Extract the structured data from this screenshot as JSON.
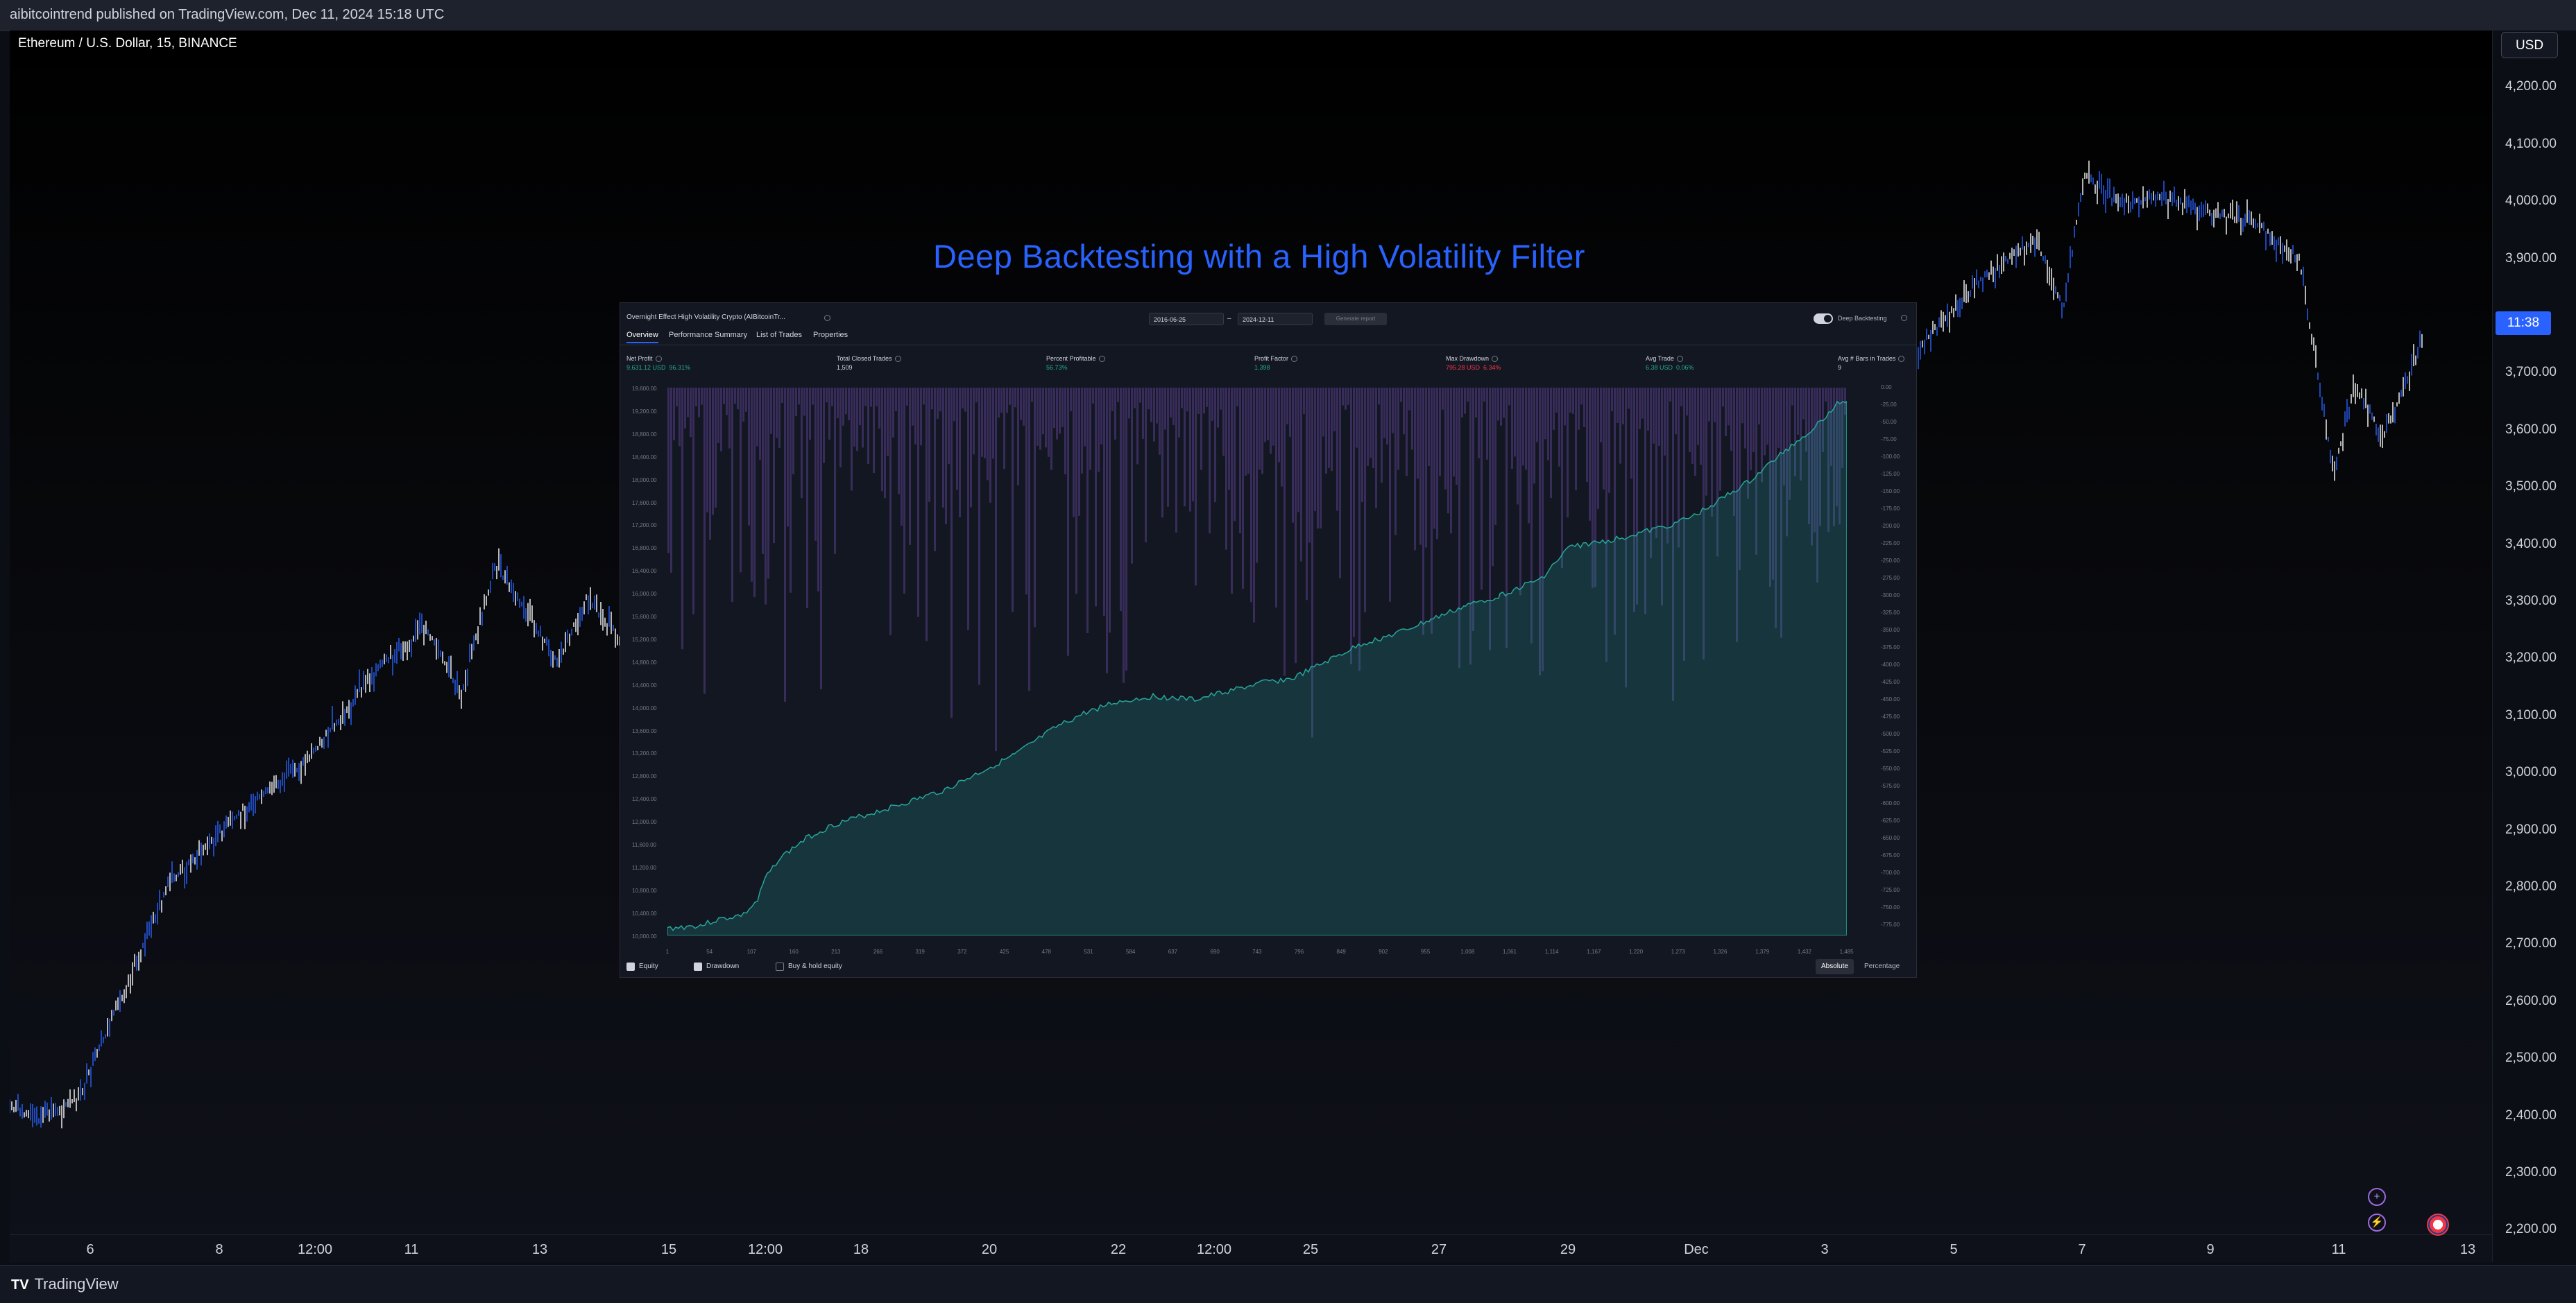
{
  "header": {
    "published_text": "aibitcointrend published on TradingView.com, Dec 11, 2024 15:18 UTC"
  },
  "chart": {
    "symbol": "Ethereum / U.S. Dollar, 15, BINANCE",
    "currency": "USD",
    "current_price_label": "11:38",
    "price_labels": [
      "4,200.00",
      "4,100.00",
      "4,000.00",
      "3,900.00",
      "3,700.00",
      "3,600.00",
      "3,500.00",
      "3,400.00",
      "3,300.00",
      "3,200.00",
      "3,100.00",
      "3,000.00",
      "2,900.00",
      "2,800.00",
      "2,700.00",
      "2,600.00",
      "2,500.00",
      "2,400.00",
      "2,300.00",
      "2,200.00"
    ],
    "time_labels": [
      "6",
      "8",
      "12:00",
      "11",
      "13",
      "15",
      "12:00",
      "18",
      "20",
      "22",
      "12:00",
      "25",
      "27",
      "29",
      "Dec",
      "3",
      "5",
      "7",
      "9",
      "11",
      "13"
    ],
    "headline": "Deep Backtesting with a High Volatility Filter",
    "colors": {
      "up": "#ffffff",
      "down": "#2962ff",
      "headline": "#2962ff"
    }
  },
  "backtest": {
    "strategy_name": "Overnight Effect High Volatility Crypto (AIBitcoinTr...",
    "start_date": "2016-06-25",
    "end_date": "2024-12-11",
    "date_separator": "–",
    "run_button": "Generate report",
    "deep_backtesting_label": "Deep Backtesting",
    "tabs": [
      "Overview",
      "Performance Summary",
      "List of Trades",
      "Properties"
    ],
    "metrics": [
      {
        "label": "Net Profit",
        "value": "9,631.12 USD",
        "pct": "96.31%",
        "color": "#22ab94"
      },
      {
        "label": "Total Closed Trades",
        "value": "1,509",
        "pct": "",
        "color": "#d1d4dc"
      },
      {
        "label": "Percent Profitable",
        "value": "56.73%",
        "pct": "",
        "color": "#22ab94"
      },
      {
        "label": "Profit Factor",
        "value": "1.398",
        "pct": "",
        "color": "#22ab94"
      },
      {
        "label": "Max Drawdown",
        "value": "795.28 USD",
        "pct": "6.34%",
        "color": "#f23645"
      },
      {
        "label": "Avg Trade",
        "value": "6.38 USD",
        "pct": "0.06%",
        "color": "#22ab94"
      },
      {
        "label": "Avg # Bars in Trades",
        "value": "9",
        "pct": "",
        "color": "#d1d4dc"
      }
    ],
    "left_axis": [
      "19,600.00",
      "19,200.00",
      "18,800.00",
      "18,400.00",
      "18,000.00",
      "17,600.00",
      "17,200.00",
      "16,800.00",
      "16,400.00",
      "16,000.00",
      "15,600.00",
      "15,200.00",
      "14,800.00",
      "14,400.00",
      "14,000.00",
      "13,600.00",
      "13,200.00",
      "12,800.00",
      "12,400.00",
      "12,000.00",
      "11,600.00",
      "11,200.00",
      "10,800.00",
      "10,400.00",
      "10,000.00"
    ],
    "right_axis": [
      "0.00",
      "-25.00",
      "-50.00",
      "-75.00",
      "-100.00",
      "-125.00",
      "-150.00",
      "-175.00",
      "-200.00",
      "-225.00",
      "-250.00",
      "-275.00",
      "-300.00",
      "-325.00",
      "-350.00",
      "-375.00",
      "-400.00",
      "-425.00",
      "-450.00",
      "-475.00",
      "-500.00",
      "-525.00",
      "-550.00",
      "-575.00",
      "-600.00",
      "-625.00",
      "-650.00",
      "-675.00",
      "-700.00",
      "-725.00",
      "-750.00",
      "-775.00"
    ],
    "bottom_axis": [
      "1",
      "54",
      "107",
      "160",
      "213",
      "266",
      "319",
      "372",
      "425",
      "478",
      "531",
      "584",
      "637",
      "690",
      "743",
      "796",
      "849",
      "902",
      "955",
      "1,008",
      "1,061",
      "1,114",
      "1,167",
      "1,220",
      "1,273",
      "1,326",
      "1,379",
      "1,432",
      "1,485"
    ],
    "legend": [
      {
        "label": "Equity",
        "checked": true
      },
      {
        "label": "Drawdown",
        "checked": true
      },
      {
        "label": "Buy & hold equity",
        "checked": false
      }
    ],
    "modes": [
      "Absolute",
      "Percentage"
    ],
    "colors": {
      "equity_fill": "#26a69a",
      "drawdown": "#7e57c2"
    }
  },
  "footer": {
    "brand": "TradingView"
  }
}
